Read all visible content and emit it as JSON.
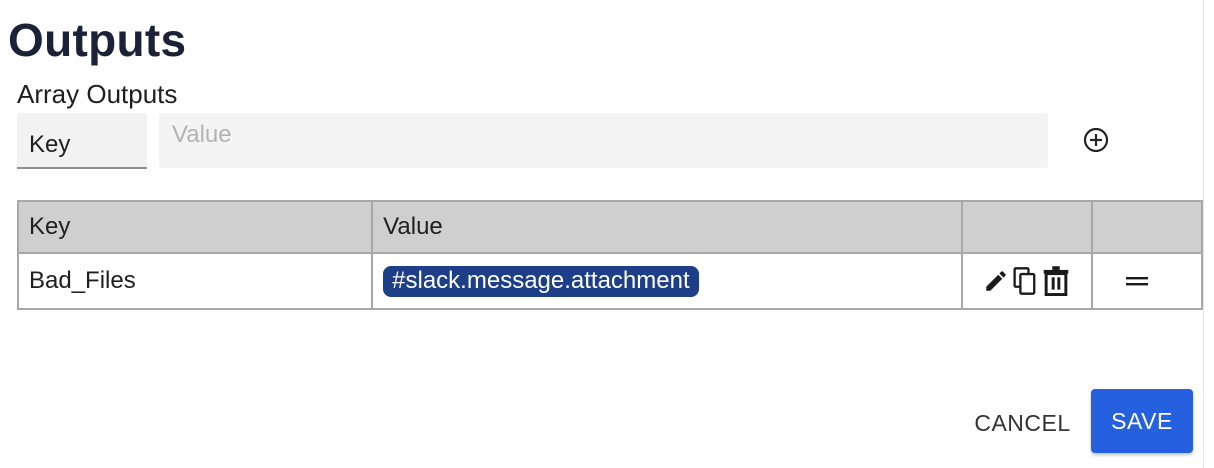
{
  "title": "Outputs",
  "section": {
    "label": "Array Outputs",
    "key_input": {
      "value": "Key"
    },
    "value_input": {
      "placeholder": "Value"
    }
  },
  "table": {
    "headers": [
      "Key",
      "Value",
      "",
      ""
    ],
    "rows": [
      {
        "key": "Bad_Files",
        "value": "#slack.message.attachment"
      }
    ]
  },
  "icons": {
    "add": "add-circle-icon",
    "edit": "pencil-icon",
    "copy": "copy-icon",
    "delete": "trash-icon",
    "drag": "drag-handle-icon"
  },
  "buttons": {
    "cancel": "CANCEL",
    "save": "SAVE"
  },
  "colors": {
    "chip": "#1d3f87",
    "save": "#2460e0",
    "header": "#cfcfcf"
  }
}
